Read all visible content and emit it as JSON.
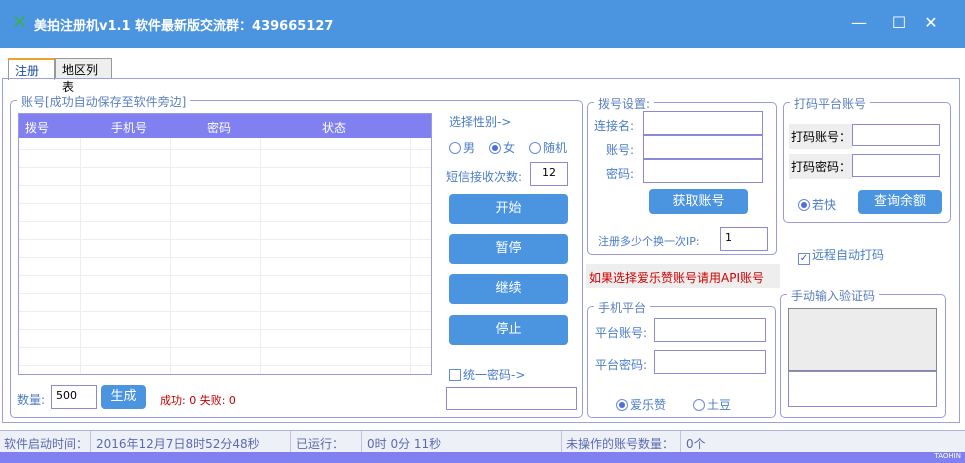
{
  "window": {
    "title": "美拍注册机v1.1  软件最新版交流群：439665127",
    "minimize": "—",
    "maximize": "☐",
    "close": "✕"
  },
  "tabs": [
    {
      "label": "注册",
      "active": true
    },
    {
      "label": "地区列表",
      "active": false
    }
  ],
  "accounts": {
    "legend": "账号[成功自动保存至软件旁边]",
    "columns": [
      "拨号",
      "手机号",
      "密码",
      "状态"
    ],
    "rows": [],
    "quantity_label": "数量:",
    "quantity_value": "500",
    "generate_label": "生成",
    "result": "成功: 0 失败: 0"
  },
  "controls": {
    "gender_label": "选择性别->",
    "genders": [
      {
        "label": "男",
        "selected": false
      },
      {
        "label": "女",
        "selected": true
      },
      {
        "label": "随机",
        "selected": false
      }
    ],
    "sms_label": "短信接收次数:",
    "sms_value": "12",
    "start": "开始",
    "pause": "暂停",
    "resume": "继续",
    "stop": "停止",
    "unify_password_label": "统一密码->",
    "unify_password_checked": false,
    "unify_password_value": ""
  },
  "dial": {
    "legend": "拨号设置:",
    "conn_label": "连接名:",
    "account_label": "账号:",
    "password_label": "密码:",
    "get_account": "获取账号",
    "ip_label": "注册多少个换一次IP:",
    "ip_value": "1"
  },
  "notice": "如果选择爱乐赞账号请用API账号",
  "captcha_platform": {
    "legend": "打码平台账号",
    "account_label": "打码账号：",
    "password_label": "打码密码：",
    "ruokuai": "若快",
    "query_balance": "查询余额"
  },
  "remote_captcha": {
    "label": "远程自动打码",
    "checked": true
  },
  "phone_platform": {
    "legend": "手机平台",
    "account_label": "平台账号:",
    "password_label": "平台密码:",
    "options": [
      {
        "label": "爱乐赞",
        "selected": true
      },
      {
        "label": "土豆",
        "selected": false
      }
    ]
  },
  "manual_captcha": {
    "legend": "手动输入验证码"
  },
  "status": {
    "start_label": "软件启动时间：",
    "start_value": "2016年12月7日8时52分48秒",
    "run_label": "已运行：",
    "run_value": "0时 0分 11秒",
    "pending_label": "未操作的账号数量：",
    "pending_value": "0个",
    "brand": "TAOHIN"
  }
}
